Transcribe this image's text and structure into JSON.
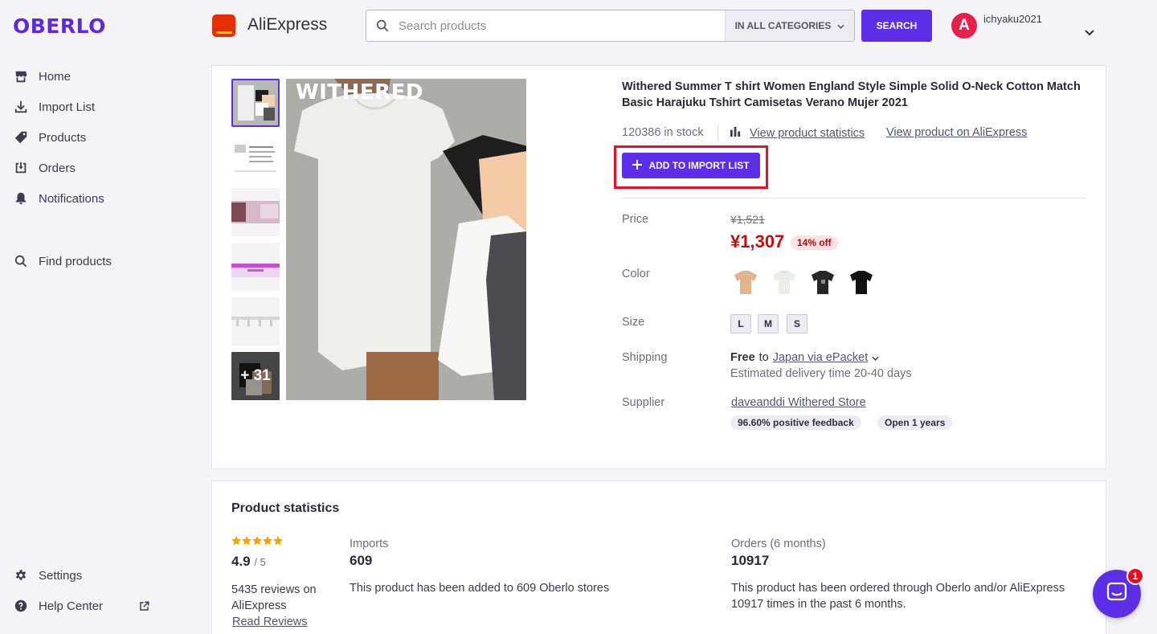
{
  "sidebar": {
    "logo": "OBERLO",
    "items": [
      {
        "label": "Home",
        "icon": "store-icon"
      },
      {
        "label": "Import List",
        "icon": "download-icon"
      },
      {
        "label": "Products",
        "icon": "tag-icon"
      },
      {
        "label": "Orders",
        "icon": "inbox-download-icon"
      },
      {
        "label": "Notifications",
        "icon": "bell-icon"
      },
      {
        "label": "Find products",
        "icon": "search-icon"
      }
    ],
    "bottom_items": [
      {
        "label": "Settings",
        "icon": "gear-icon"
      },
      {
        "label": "Help Center",
        "icon": "help-icon",
        "trailing_icon": "external-link-icon"
      }
    ]
  },
  "header": {
    "marketplace_name": "AliExpress",
    "search_placeholder": "Search products",
    "category_select": "IN ALL CATEGORIES",
    "search_button": "SEARCH",
    "avatar_letter": "A",
    "username": "ichyaku2021"
  },
  "product": {
    "title": "Withered Summer T shirt Women England Style Simple Solid O-Neck Cotton Match Basic Harajuku Tshirt Camisetas Verano Mujer 2021",
    "image_label": "WITHERED",
    "more_images": "+ 31",
    "stock": "120386 in stock",
    "stats_link": "View product statistics",
    "aliexpress_link": "View product on AliExpress",
    "add_button": "ADD TO IMPORT LIST",
    "price_label": "Price",
    "old_price": "¥1,521",
    "new_price": "¥1,307",
    "discount": "14% off",
    "color_label": "Color",
    "colors": [
      "beige",
      "white",
      "black-print",
      "black"
    ],
    "size_label": "Size",
    "sizes": [
      "L",
      "M",
      "S"
    ],
    "shipping_label": "Shipping",
    "shipping_free": "Free",
    "shipping_to": "to",
    "shipping_method": "Japan via ePacket",
    "delivery": "Estimated delivery time 20-40 days",
    "supplier_label": "Supplier",
    "supplier_name": "daveanddi Withered Store",
    "feedback": "96.60% positive feedback",
    "open_years": "Open 1 years"
  },
  "stats": {
    "title": "Product statistics",
    "stars": 5,
    "rating": "4.9",
    "rating_max": "/ 5",
    "reviews": "5435 reviews on AliExpress",
    "read_reviews": "Read Reviews",
    "imports_label": "Imports",
    "imports_value": "609",
    "imports_desc": "This product has been added to 609 Oberlo stores",
    "orders_label": "Orders (6 months)",
    "orders_value": "10917",
    "orders_desc": "This product has been ordered through Oberlo and/or AliExpress 10917 times in the past 6 months."
  },
  "chat": {
    "badge_count": "1"
  },
  "colors": {
    "accent": "#5c2ee8",
    "price_red": "#c40f0f",
    "highlight": "#e8102a"
  }
}
